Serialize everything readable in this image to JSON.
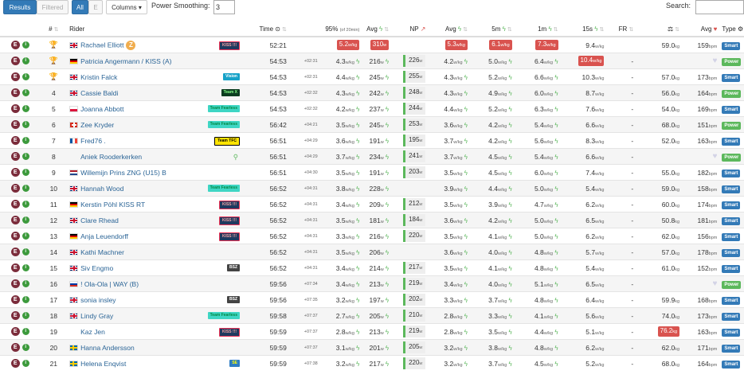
{
  "toolbar": {
    "results": "Results",
    "filtered": "Filtered",
    "all": "All",
    "e": "E",
    "columns": "Columns",
    "power_smoothing_label": "Power Smoothing:",
    "power_smoothing_value": "3",
    "search_label": "Search:",
    "search_value": ""
  },
  "headers": {
    "pos": "#",
    "rider": "Rider",
    "time": "Time",
    "p95": "95%",
    "p95_sub": "(of 20min)",
    "avg": "Avg",
    "np": "NP",
    "avgwkg": "Avg",
    "p5m": "5m",
    "p1m": "1m",
    "p15s": "15s",
    "fr": "FR",
    "hr_avg": "Avg",
    "type": "Type"
  },
  "colors": {
    "accent": "#337ab7",
    "danger": "#d9534f",
    "success": "#5cb85c",
    "e_badge": "#7b2c3b"
  },
  "rows": [
    {
      "pos": "",
      "trophy": "gold",
      "flag": "gb",
      "name": "Rachael Elliott",
      "zbadge": "Z",
      "team": "KISS !!!",
      "team_style": "kiss",
      "time": "52:21",
      "gap": "",
      "p95": "5.2",
      "p95_hl": true,
      "avg": "310",
      "avg_hl": true,
      "np": "",
      "wkg": "5.3",
      "wkg_hl": true,
      "m5": "6.1",
      "m5_hl": true,
      "m1": "7.3",
      "m1_hl": true,
      "s15": "9.4",
      "s15_hl": false,
      "fr": "",
      "weight": "59.0",
      "weight_hl": false,
      "hr": "159",
      "heart": false,
      "type": "Smart"
    },
    {
      "pos": "",
      "trophy": "silver",
      "flag": "de",
      "name": "Patricia Angermann / KISS (A)",
      "zbadge": "",
      "team": "",
      "team_style": "",
      "time": "54:53",
      "gap": "+02:31",
      "p95": "4.3",
      "p95_hl": false,
      "avg": "216",
      "avg_hl": false,
      "np": "226",
      "wkg": "4.2",
      "wkg_hl": false,
      "m5": "5.0",
      "m5_hl": false,
      "m1": "6.4",
      "m1_hl": false,
      "s15": "10.4",
      "s15_hl": true,
      "fr": "-",
      "weight": "",
      "weight_hl": false,
      "hr": "",
      "heart": true,
      "type": "Power"
    },
    {
      "pos": "",
      "trophy": "bronze",
      "flag": "gb",
      "name": "Kristin Falck",
      "zbadge": "",
      "team": "Vision",
      "team_style": "vision",
      "time": "54:53",
      "gap": "+02:31",
      "p95": "4.4",
      "p95_hl": false,
      "avg": "245",
      "avg_hl": false,
      "np": "255",
      "wkg": "4.3",
      "wkg_hl": false,
      "m5": "5.2",
      "m5_hl": false,
      "m1": "6.6",
      "m1_hl": false,
      "s15": "10.3",
      "s15_hl": false,
      "fr": "-",
      "weight": "57.0",
      "weight_hl": false,
      "hr": "173",
      "heart": false,
      "type": "Smart"
    },
    {
      "pos": "4",
      "trophy": "",
      "flag": "gb",
      "name": "Cassie Baldi",
      "zbadge": "",
      "team": "Team X",
      "team_style": "teamx",
      "time": "54:53",
      "gap": "+02:32",
      "p95": "4.3",
      "p95_hl": false,
      "avg": "242",
      "avg_hl": false,
      "np": "248",
      "wkg": "4.3",
      "wkg_hl": false,
      "m5": "4.9",
      "m5_hl": false,
      "m1": "6.0",
      "m1_hl": false,
      "s15": "8.7",
      "s15_hl": false,
      "fr": "-",
      "weight": "56.0",
      "weight_hl": false,
      "hr": "164",
      "heart": false,
      "type": "Power"
    },
    {
      "pos": "5",
      "trophy": "",
      "flag": "pl",
      "name": "Joanna Abbott",
      "zbadge": "",
      "team": "Team Fearless",
      "team_style": "fearless",
      "time": "54:53",
      "gap": "+02:32",
      "p95": "4.2",
      "p95_hl": false,
      "avg": "237",
      "avg_hl": false,
      "np": "244",
      "wkg": "4.4",
      "wkg_hl": false,
      "m5": "5.2",
      "m5_hl": false,
      "m1": "6.3",
      "m1_hl": false,
      "s15": "7.6",
      "s15_hl": false,
      "fr": "-",
      "weight": "54.0",
      "weight_hl": false,
      "hr": "169",
      "heart": false,
      "type": "Smart"
    },
    {
      "pos": "6",
      "trophy": "",
      "flag": "ch",
      "name": "Zee Kryder",
      "zbadge": "",
      "team": "Team Fearless",
      "team_style": "fearless",
      "time": "56:42",
      "gap": "+04:21",
      "p95": "3.5",
      "p95_hl": false,
      "avg": "245",
      "avg_hl": false,
      "np": "253",
      "wkg": "3.6",
      "wkg_hl": false,
      "m5": "4.2",
      "m5_hl": false,
      "m1": "5.4",
      "m1_hl": false,
      "s15": "6.6",
      "s15_hl": false,
      "fr": "-",
      "weight": "68.0",
      "weight_hl": false,
      "hr": "151",
      "heart": false,
      "type": "Power"
    },
    {
      "pos": "7",
      "trophy": "",
      "flag": "fr",
      "name": "Fred76 .",
      "zbadge": "",
      "team": "Team TFC",
      "team_style": "tfc",
      "time": "56:51",
      "gap": "+04:29",
      "p95": "3.6",
      "p95_hl": false,
      "avg": "191",
      "avg_hl": false,
      "np": "195",
      "wkg": "3.7",
      "wkg_hl": false,
      "m5": "4.2",
      "m5_hl": false,
      "m1": "5.6",
      "m1_hl": false,
      "s15": "8.3",
      "s15_hl": false,
      "fr": "-",
      "weight": "52.0",
      "weight_hl": false,
      "hr": "163",
      "heart": false,
      "type": "Smart"
    },
    {
      "pos": "8",
      "trophy": "",
      "flag": "",
      "name": "Aniek Rooderkerken",
      "zbadge": "",
      "team": "",
      "team_style": "search",
      "time": "56:51",
      "gap": "+04:29",
      "p95": "3.7",
      "p95_hl": false,
      "avg": "234",
      "avg_hl": false,
      "np": "241",
      "wkg": "3.7",
      "wkg_hl": false,
      "m5": "4.5",
      "m5_hl": false,
      "m1": "5.4",
      "m1_hl": false,
      "s15": "6.6",
      "s15_hl": false,
      "fr": "-",
      "weight": "",
      "weight_hl": false,
      "hr": "",
      "heart": true,
      "type": "Power"
    },
    {
      "pos": "9",
      "trophy": "",
      "flag": "nl",
      "name": "Willemijn Prins ZNG (U15) B",
      "zbadge": "",
      "team": "",
      "team_style": "",
      "time": "56:51",
      "gap": "+04:30",
      "p95": "3.5",
      "p95_hl": false,
      "avg": "191",
      "avg_hl": false,
      "np": "203",
      "wkg": "3.5",
      "wkg_hl": false,
      "m5": "4.5",
      "m5_hl": false,
      "m1": "6.0",
      "m1_hl": false,
      "s15": "7.4",
      "s15_hl": false,
      "fr": "-",
      "weight": "55.0",
      "weight_hl": false,
      "hr": "182",
      "heart": false,
      "type": "Smart"
    },
    {
      "pos": "10",
      "trophy": "",
      "flag": "gb",
      "name": "Hannah Wood",
      "zbadge": "",
      "team": "Team Fearless",
      "team_style": "fearless",
      "time": "56:52",
      "gap": "+04:31",
      "p95": "3.8",
      "p95_hl": false,
      "avg": "228",
      "avg_hl": false,
      "np": "",
      "wkg": "3.9",
      "wkg_hl": false,
      "m5": "4.4",
      "m5_hl": false,
      "m1": "5.0",
      "m1_hl": false,
      "s15": "5.4",
      "s15_hl": false,
      "fr": "-",
      "weight": "59.0",
      "weight_hl": false,
      "hr": "158",
      "heart": false,
      "type": "Smart"
    },
    {
      "pos": "11",
      "trophy": "",
      "flag": "de",
      "name": "Kerstin Pöhl KISS RT",
      "zbadge": "",
      "team": "KISS !!!",
      "team_style": "kiss",
      "time": "56:52",
      "gap": "+04:31",
      "p95": "3.4",
      "p95_hl": false,
      "avg": "209",
      "avg_hl": false,
      "np": "212",
      "wkg": "3.5",
      "wkg_hl": false,
      "m5": "3.9",
      "m5_hl": false,
      "m1": "4.7",
      "m1_hl": false,
      "s15": "6.2",
      "s15_hl": false,
      "fr": "-",
      "weight": "60.0",
      "weight_hl": false,
      "hr": "174",
      "heart": false,
      "type": "Smart"
    },
    {
      "pos": "12",
      "trophy": "",
      "flag": "gb",
      "name": "Clare Rhead",
      "zbadge": "",
      "team": "KISS !!!",
      "team_style": "kiss",
      "time": "56:52",
      "gap": "+04:31",
      "p95": "3.5",
      "p95_hl": false,
      "avg": "181",
      "avg_hl": false,
      "np": "184",
      "wkg": "3.6",
      "wkg_hl": false,
      "m5": "4.2",
      "m5_hl": false,
      "m1": "5.0",
      "m1_hl": false,
      "s15": "6.5",
      "s15_hl": false,
      "fr": "-",
      "weight": "50.8",
      "weight_hl": false,
      "hr": "181",
      "heart": false,
      "type": "Smart"
    },
    {
      "pos": "13",
      "trophy": "",
      "flag": "de",
      "name": "Anja Leuendorff",
      "zbadge": "",
      "team": "KISS !!!",
      "team_style": "kiss",
      "time": "56:52",
      "gap": "+04:31",
      "p95": "3.3",
      "p95_hl": false,
      "avg": "216",
      "avg_hl": false,
      "np": "220",
      "wkg": "3.5",
      "wkg_hl": false,
      "m5": "4.1",
      "m5_hl": false,
      "m1": "5.0",
      "m1_hl": false,
      "s15": "6.2",
      "s15_hl": false,
      "fr": "-",
      "weight": "62.0",
      "weight_hl": false,
      "hr": "156",
      "heart": false,
      "type": "Smart"
    },
    {
      "pos": "14",
      "trophy": "",
      "flag": "gb",
      "name": "Kathi Machner",
      "zbadge": "",
      "team": "",
      "team_style": "",
      "time": "56:52",
      "gap": "+04:31",
      "p95": "3.5",
      "p95_hl": false,
      "avg": "206",
      "avg_hl": false,
      "np": "",
      "wkg": "3.6",
      "wkg_hl": false,
      "m5": "4.0",
      "m5_hl": false,
      "m1": "4.8",
      "m1_hl": false,
      "s15": "5.7",
      "s15_hl": false,
      "fr": "-",
      "weight": "57.0",
      "weight_hl": false,
      "hr": "178",
      "heart": false,
      "type": "Smart"
    },
    {
      "pos": "15",
      "trophy": "",
      "flag": "gb",
      "name": "Siv Engmo",
      "zbadge": "",
      "team": "BSZ",
      "team_style": "bsz",
      "time": "56:52",
      "gap": "+04:31",
      "p95": "3.4",
      "p95_hl": false,
      "avg": "214",
      "avg_hl": false,
      "np": "217",
      "wkg": "3.5",
      "wkg_hl": false,
      "m5": "4.1",
      "m5_hl": false,
      "m1": "4.8",
      "m1_hl": false,
      "s15": "5.4",
      "s15_hl": false,
      "fr": "-",
      "weight": "61.0",
      "weight_hl": false,
      "hr": "152",
      "heart": false,
      "type": "Smart"
    },
    {
      "pos": "16",
      "trophy": "",
      "flag": "ru",
      "name": "! Ola-Ola | WAY (B)",
      "zbadge": "",
      "team": "",
      "team_style": "",
      "time": "59:56",
      "gap": "+07:34",
      "p95": "3.4",
      "p95_hl": false,
      "avg": "213",
      "avg_hl": false,
      "np": "219",
      "wkg": "3.4",
      "wkg_hl": false,
      "m5": "4.0",
      "m5_hl": false,
      "m1": "5.1",
      "m1_hl": false,
      "s15": "6.5",
      "s15_hl": false,
      "fr": "-",
      "weight": "",
      "weight_hl": false,
      "hr": "",
      "heart": true,
      "type": "Power"
    },
    {
      "pos": "17",
      "trophy": "",
      "flag": "gb",
      "name": "sonia insley",
      "zbadge": "",
      "team": "BSZ",
      "team_style": "bsz",
      "time": "59:56",
      "gap": "+07:35",
      "p95": "3.2",
      "p95_hl": false,
      "avg": "197",
      "avg_hl": false,
      "np": "202",
      "wkg": "3.3",
      "wkg_hl": false,
      "m5": "3.7",
      "m5_hl": false,
      "m1": "4.8",
      "m1_hl": false,
      "s15": "6.4",
      "s15_hl": false,
      "fr": "-",
      "weight": "59.9",
      "weight_hl": false,
      "hr": "168",
      "heart": false,
      "type": "Smart"
    },
    {
      "pos": "18",
      "trophy": "",
      "flag": "gb",
      "name": "Lindy Gray",
      "zbadge": "",
      "team": "Team Fearless",
      "team_style": "fearless",
      "time": "59:58",
      "gap": "+07:37",
      "p95": "2.7",
      "p95_hl": false,
      "avg": "205",
      "avg_hl": false,
      "np": "210",
      "wkg": "2.8",
      "wkg_hl": false,
      "m5": "3.3",
      "m5_hl": false,
      "m1": "4.1",
      "m1_hl": false,
      "s15": "5.6",
      "s15_hl": false,
      "fr": "-",
      "weight": "74.0",
      "weight_hl": false,
      "hr": "173",
      "heart": false,
      "type": "Smart"
    },
    {
      "pos": "19",
      "trophy": "",
      "flag": "",
      "name": "Kaz Jen",
      "zbadge": "",
      "team": "KISS !!!",
      "team_style": "kiss",
      "time": "59:59",
      "gap": "+07:37",
      "p95": "2.8",
      "p95_hl": false,
      "avg": "213",
      "avg_hl": false,
      "np": "219",
      "wkg": "2.8",
      "wkg_hl": false,
      "m5": "3.5",
      "m5_hl": false,
      "m1": "4.4",
      "m1_hl": false,
      "s15": "5.1",
      "s15_hl": false,
      "fr": "-",
      "weight": "76.2",
      "weight_hl": true,
      "hr": "163",
      "heart": false,
      "type": "Smart"
    },
    {
      "pos": "20",
      "trophy": "",
      "flag": "se",
      "name": "Hanna Andersson",
      "zbadge": "",
      "team": "",
      "team_style": "",
      "time": "59:59",
      "gap": "+07:37",
      "p95": "3.1",
      "p95_hl": false,
      "avg": "201",
      "avg_hl": false,
      "np": "205",
      "wkg": "3.2",
      "wkg_hl": false,
      "m5": "3.8",
      "m5_hl": false,
      "m1": "4.8",
      "m1_hl": false,
      "s15": "6.2",
      "s15_hl": false,
      "fr": "-",
      "weight": "62.0",
      "weight_hl": false,
      "hr": "171",
      "heart": false,
      "type": "Smart"
    },
    {
      "pos": "21",
      "trophy": "",
      "flag": "se",
      "name": "Helena Enqvist",
      "zbadge": "",
      "team": "SE",
      "team_style": "se",
      "time": "59:59",
      "gap": "+07:38",
      "p95": "3.2",
      "p95_hl": false,
      "avg": "217",
      "avg_hl": false,
      "np": "220",
      "wkg": "3.2",
      "wkg_hl": false,
      "m5": "3.7",
      "m5_hl": false,
      "m1": "4.5",
      "m1_hl": false,
      "s15": "5.2",
      "s15_hl": false,
      "fr": "-",
      "weight": "68.0",
      "weight_hl": false,
      "hr": "164",
      "heart": false,
      "type": "Smart"
    }
  ]
}
